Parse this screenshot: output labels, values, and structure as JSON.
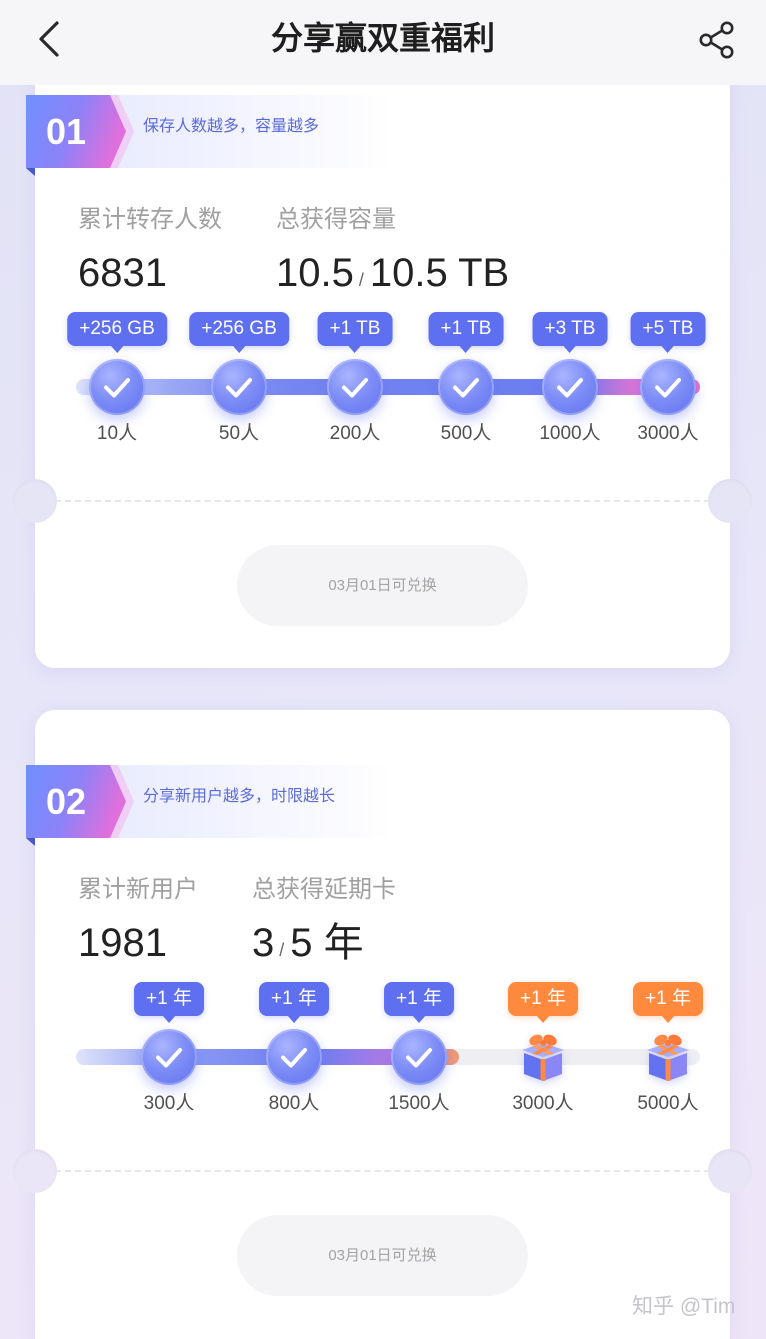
{
  "header": {
    "title": "分享赢双重福利",
    "back_icon": "chevron-left-icon",
    "share_icon": "share-icon"
  },
  "colors": {
    "accent_blue": "#5e6ff0",
    "accent_orange": "#ff8a3d",
    "accent_pink": "#e36fd2",
    "tagline": "#5b6cd9",
    "text_primary": "#222222",
    "text_secondary": "#a0a0a0"
  },
  "cards": [
    {
      "index": "01",
      "tagline": "保存人数越多，容量越多",
      "stat_left": {
        "label": "累计转存人数",
        "value": "6831"
      },
      "stat_right": {
        "label": "总获得容量",
        "value": "10.5",
        "separator": "/",
        "total": "10.5 TB"
      },
      "current_count": 6831,
      "milestones": [
        {
          "reward": "+256 GB",
          "threshold_label": "10人",
          "threshold": 10,
          "reached": true,
          "icon": "check-icon"
        },
        {
          "reward": "+256 GB",
          "threshold_label": "50人",
          "threshold": 50,
          "reached": true,
          "icon": "check-icon"
        },
        {
          "reward": "+1 TB",
          "threshold_label": "200人",
          "threshold": 200,
          "reached": true,
          "icon": "check-icon"
        },
        {
          "reward": "+1 TB",
          "threshold_label": "500人",
          "threshold": 500,
          "reached": true,
          "icon": "check-icon"
        },
        {
          "reward": "+3 TB",
          "threshold_label": "1000人",
          "threshold": 1000,
          "reached": true,
          "icon": "check-icon"
        },
        {
          "reward": "+5 TB",
          "threshold_label": "3000人",
          "threshold": 3000,
          "reached": true,
          "icon": "check-icon"
        }
      ],
      "redeem_button": "03月01日可兑换"
    },
    {
      "index": "02",
      "tagline": "分享新用户越多，时限越长",
      "stat_left": {
        "label": "累计新用户",
        "value": "1981"
      },
      "stat_right": {
        "label": "总获得延期卡",
        "value": "3",
        "separator": "/",
        "total": "5 年"
      },
      "current_count": 1981,
      "milestones": [
        {
          "reward": "+1 年",
          "threshold_label": "300人",
          "threshold": 300,
          "reached": true,
          "icon": "check-icon"
        },
        {
          "reward": "+1 年",
          "threshold_label": "800人",
          "threshold": 800,
          "reached": true,
          "icon": "check-icon"
        },
        {
          "reward": "+1 年",
          "threshold_label": "1500人",
          "threshold": 1500,
          "reached": true,
          "icon": "check-icon"
        },
        {
          "reward": "+1 年",
          "threshold_label": "3000人",
          "threshold": 3000,
          "reached": false,
          "icon": "gift-icon"
        },
        {
          "reward": "+1 年",
          "threshold_label": "5000人",
          "threshold": 5000,
          "reached": false,
          "icon": "gift-icon"
        }
      ],
      "redeem_button": "03月01日可兑换"
    }
  ],
  "watermark": "知乎 @Tim"
}
